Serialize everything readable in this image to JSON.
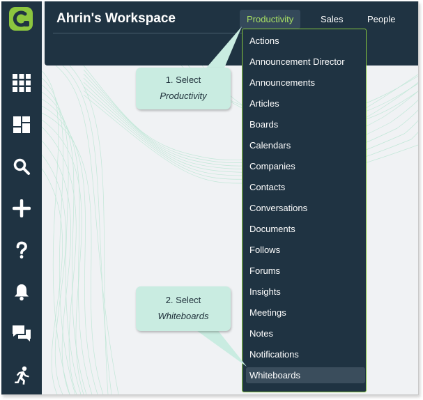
{
  "header": {
    "title": "Ahrin's Workspace",
    "tabs": [
      "Productivity",
      "Sales",
      "People"
    ],
    "active_tab": "Productivity"
  },
  "sidebar": {
    "items": [
      {
        "icon": "apps-grid-icon"
      },
      {
        "icon": "dashboard-icon"
      },
      {
        "icon": "search-icon"
      },
      {
        "icon": "plus-icon"
      },
      {
        "icon": "help-icon"
      },
      {
        "icon": "bell-icon"
      },
      {
        "icon": "chat-icon"
      },
      {
        "icon": "activity-icon"
      }
    ]
  },
  "menu": {
    "items": [
      "Actions",
      "Announcement Director",
      "Announcements",
      "Articles",
      "Boards",
      "Calendars",
      "Companies",
      "Contacts",
      "Conversations",
      "Documents",
      "Follows",
      "Forums",
      "Insights",
      "Meetings",
      "Notes",
      "Notifications",
      "Whiteboards"
    ],
    "highlighted": "Whiteboards"
  },
  "callouts": {
    "step1": {
      "line1": "1. Select",
      "line2": "Productivity"
    },
    "step2": {
      "line1": "2. Select",
      "line2": "Whiteboards"
    }
  },
  "colors": {
    "navy": "#1f3342",
    "accent_green": "#86c63f",
    "active_tab_text": "#a8e063",
    "callout_bg": "#c9ece1"
  }
}
